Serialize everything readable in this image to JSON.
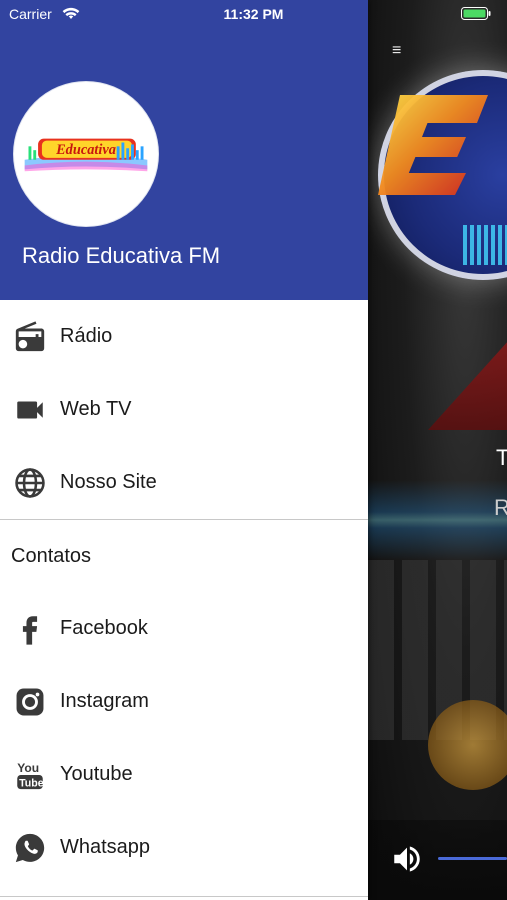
{
  "status_bar": {
    "carrier": "Carrier",
    "time": "11:32 PM"
  },
  "drawer": {
    "header": {
      "title": "Radio Educativa FM",
      "logo_text": "Educativa",
      "background_color": "#3244a0"
    },
    "menu": [
      {
        "label": "Rádio",
        "icon": "radio-icon"
      },
      {
        "label": "Web TV",
        "icon": "video-camera-icon"
      },
      {
        "label": "Nosso Site",
        "icon": "globe-icon"
      }
    ],
    "contacts_section": {
      "title": "Contatos",
      "items": [
        {
          "label": "Facebook",
          "icon": "facebook-icon"
        },
        {
          "label": "Instagram",
          "icon": "instagram-icon"
        },
        {
          "label": "Youtube",
          "icon": "youtube-icon"
        },
        {
          "label": "Whatsapp",
          "icon": "whatsapp-icon"
        }
      ]
    }
  },
  "background_app": {
    "partial_letters": [
      "T",
      "R"
    ],
    "slider_color": "#4a6ad8"
  }
}
